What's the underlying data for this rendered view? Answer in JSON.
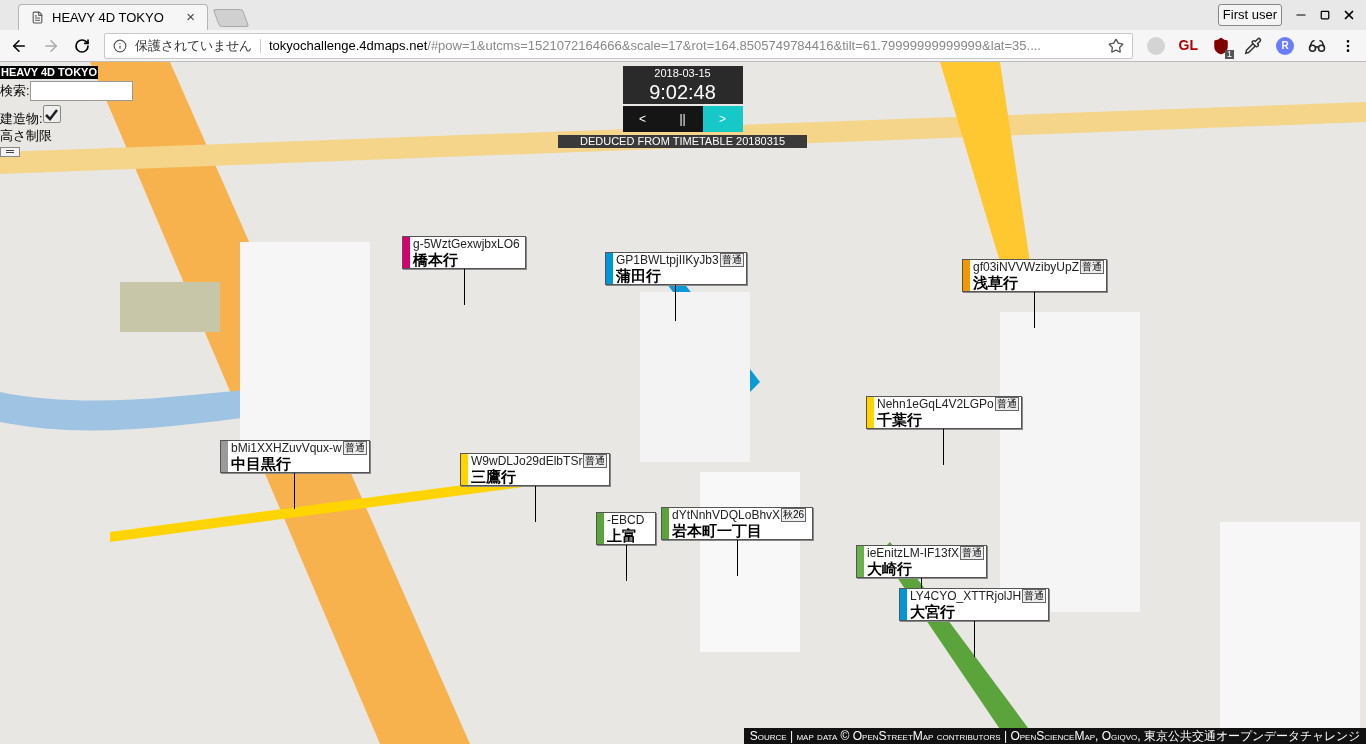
{
  "browser": {
    "tab_title": "HEAVY 4D TOKYO",
    "tab_close": "×",
    "profile": "First user",
    "security": "保護されていません",
    "url_host": "tokyochallenge.4dmaps.net",
    "url_rest": "/#pow=1&utcms=1521072164666&scale=17&rot=164.8505749784416&tilt=61.79999999999999&lat=35....",
    "extensions": [
      {
        "kind": "circle"
      },
      {
        "kind": "text",
        "text": "GL"
      },
      {
        "kind": "shield",
        "text": "1"
      },
      {
        "kind": "dropper"
      },
      {
        "kind": "badge",
        "text": "R"
      },
      {
        "kind": "glasses"
      }
    ]
  },
  "panel": {
    "title": "HEAVY 4D TOKYO",
    "search_label": "検索:",
    "buildings_label": "建造物:",
    "buildings_checked": true,
    "height_label": "高さ制限"
  },
  "clock": {
    "date": "2018-03-15",
    "time": "9:02:48",
    "controls": [
      {
        "label": "<",
        "selected": false
      },
      {
        "label": "||",
        "selected": false
      },
      {
        "label": ">",
        "selected": true
      }
    ],
    "source_banner": "DEDUCED FROM TIMETABLE 20180315"
  },
  "trains": [
    {
      "id": "g-5WztGexwjbxLO6",
      "destination": "橋本行",
      "color": "#d6006f"
    },
    {
      "id": "GP1BWLtpjIIKyJb3",
      "type": "普通",
      "destination": "蒲田行",
      "color": "#0097d6"
    },
    {
      "id": "gf03iNVVWzibyUpZ",
      "type": "普通",
      "destination": "浅草行",
      "color": "#f39800"
    },
    {
      "id": "bMi1XXHZuvVqux-w",
      "type": "普通",
      "destination": "中目黒行",
      "color": "#9a9a9a"
    },
    {
      "id": "W9wDLJo29dElbTSr",
      "type": "普通",
      "destination": "三鷹行",
      "color": "#ffd400"
    },
    {
      "id": "Nehn1eGqL4V2LGPo",
      "type": "普通",
      "destination": "千葉行",
      "color": "#ffd400"
    },
    {
      "id": "-EBCD",
      "destination": "上富",
      "color": "#5ba33b"
    },
    {
      "id": "dYtNnhVDQLoBhvX",
      "type": "秋26",
      "destination": "岩本町一丁目",
      "color": "#5ba33b"
    },
    {
      "id": "ieEnitzLM-IF13fX",
      "type": "普通",
      "destination": "大崎行",
      "color": "#6ab04c"
    },
    {
      "id": "LY4CYO_XTTRjolJH",
      "type": "普通",
      "destination": "大宮行",
      "color": "#0097d6"
    }
  ],
  "attribution": "Source | map data © OpenStreetMap contributors | OpenScienceMap, Ogiqvo, 東京公共交通オープンデータチャレンジ"
}
